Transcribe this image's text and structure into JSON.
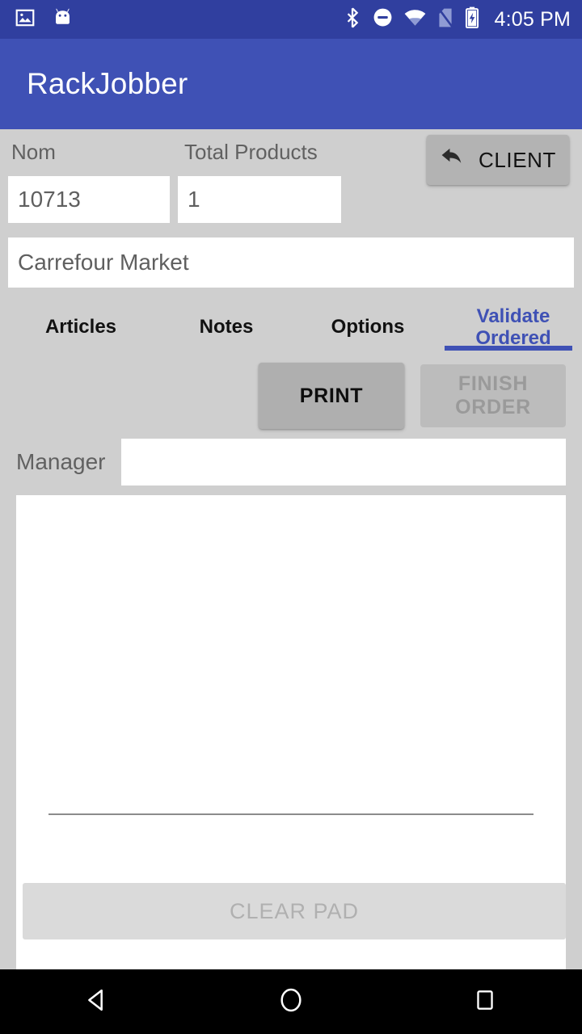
{
  "status_bar": {
    "icons_left": [
      "image-icon",
      "android-robot-icon"
    ],
    "icons_right": [
      "bluetooth-icon",
      "do-not-disturb-icon",
      "wifi-icon",
      "no-sim-icon",
      "battery-charging-icon"
    ],
    "time": "4:05 PM",
    "background_color": "#303F9F"
  },
  "app_bar": {
    "title": "RackJobber",
    "background_color": "#3F51B5",
    "text_color": "#FFFFFF"
  },
  "form": {
    "nom_label": "Nom",
    "nom_value": "10713",
    "total_products_label": "Total Products",
    "total_products_value": "1",
    "client_name_value": "Carrefour Market",
    "client_button_label": "CLIENT",
    "client_button_icon": "undo-arrow-icon"
  },
  "tabs": {
    "active_index": 3,
    "active_color": "#3F51B5",
    "items": [
      {
        "label": "Articles"
      },
      {
        "label": "Notes"
      },
      {
        "label": "Options"
      },
      {
        "label": "Validate Ordered",
        "line1": "Validate",
        "line2": "Ordered"
      }
    ]
  },
  "actions": {
    "print_label": "PRINT",
    "print_enabled": true,
    "finish_order_label": "FINISH ORDER",
    "finish_order_enabled": false
  },
  "signature": {
    "manager_label": "Manager",
    "manager_value": "",
    "pad_placeholder": "",
    "clear_pad_label": "CLEAR PAD",
    "clear_pad_enabled": false
  },
  "nav_bar": {
    "back_icon": "back-triangle-icon",
    "home_icon": "home-circle-icon",
    "recents_icon": "recents-square-icon",
    "background_color": "#000000"
  }
}
